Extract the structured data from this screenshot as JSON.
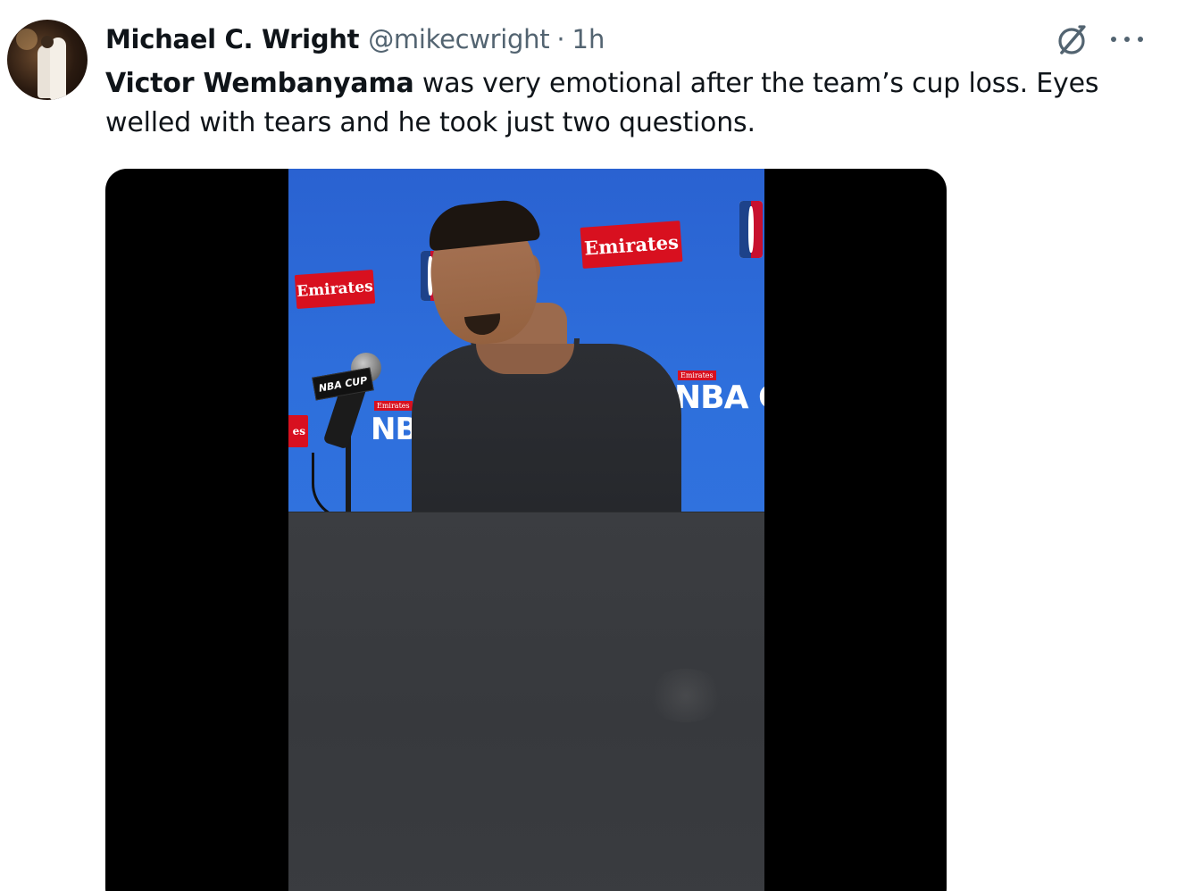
{
  "tweet": {
    "author_name": "Michael C. Wright",
    "handle": "@mikecwright",
    "separator": "·",
    "time": "1h",
    "text_mention": "Victor Wembanyama",
    "text_rest": " was very emotional after the team’s cup loss. Eyes welled with tears and he took just two questions."
  },
  "media": {
    "backdrop_sponsor_1": "Emirates",
    "backdrop_sponsor_2": "Emirates",
    "backdrop_sponsor_left_edge": "es",
    "cup_label_1": "NBA CUP",
    "cup_label_2": "NBA",
    "cup_small_1": "Emirates",
    "cup_small_2": "Emirates",
    "mic_flag": "NBA CUP"
  },
  "colors": {
    "text_primary": "#0f1419",
    "text_secondary": "#536471",
    "backdrop_blue": "#2e6fdc",
    "sponsor_red": "#d8101f"
  },
  "icons": {
    "grok": "grok-icon",
    "more": "more-icon"
  }
}
